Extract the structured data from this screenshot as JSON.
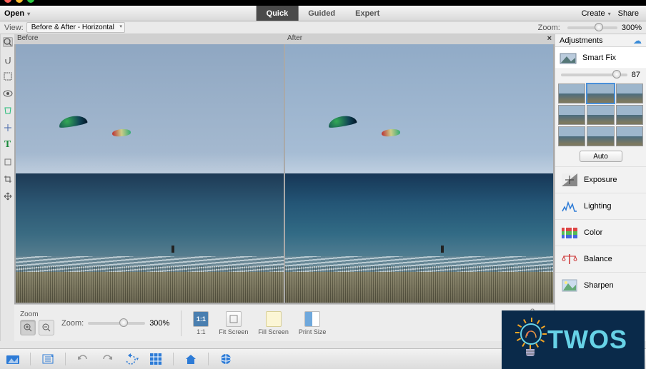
{
  "traffic_lights": [
    "close",
    "minimize",
    "maximize"
  ],
  "menubar": {
    "open_label": "Open",
    "tabs": [
      {
        "label": "Quick",
        "active": true
      },
      {
        "label": "Guided",
        "active": false
      },
      {
        "label": "Expert",
        "active": false
      }
    ],
    "create_label": "Create",
    "share_label": "Share"
  },
  "viewbar": {
    "view_label": "View:",
    "view_mode": "Before & After - Horizontal",
    "zoom_label": "Zoom:",
    "zoom_value": "300%",
    "zoom_slider_pos": 0.55
  },
  "tools": [
    "zoom",
    "hand",
    "select",
    "eye",
    "crop",
    "drop",
    "text",
    "rect",
    "move"
  ],
  "compare": {
    "before_label": "Before",
    "after_label": "After",
    "close_glyph": "×"
  },
  "zoombar": {
    "title": "Zoom",
    "zoom_label": "Zoom:",
    "zoom_value": "300%",
    "slider_pos": 0.55,
    "buttons": [
      {
        "name": "zoom-in-button",
        "glyph": "+",
        "active": true
      },
      {
        "name": "zoom-out-button",
        "glyph": "−",
        "active": false
      }
    ],
    "fit_items": [
      {
        "name": "one-to-one",
        "icon_text": "1:1",
        "label": "1:1"
      },
      {
        "name": "fit-screen",
        "icon_text": "",
        "label": "Fit Screen"
      },
      {
        "name": "fill-screen",
        "icon_text": "",
        "label": "Fill Screen"
      },
      {
        "name": "print-size",
        "icon_text": "",
        "label": "Print Size"
      }
    ],
    "help_glyph": "?",
    "menu_glyph": "▾"
  },
  "adjustments": {
    "header": "Adjustments",
    "cloud_icon": "cloud-sync-icon",
    "smart_fix": {
      "label": "Smart Fix",
      "value": "87",
      "slider_pos": 0.78,
      "auto_label": "Auto",
      "selected_variant_index": 1
    },
    "items": [
      {
        "name": "exposure",
        "label": "Exposure"
      },
      {
        "name": "lighting",
        "label": "Lighting"
      },
      {
        "name": "color",
        "label": "Color"
      },
      {
        "name": "balance",
        "label": "Balance"
      },
      {
        "name": "sharpen",
        "label": "Sharpen"
      }
    ]
  },
  "appbar": {
    "icons": [
      "photo-bin",
      "organizer",
      "undo",
      "redo",
      "rotate",
      "grid",
      "home",
      "layers-globe"
    ]
  },
  "logo": {
    "text": "TWOS"
  },
  "colors": {
    "accent": "#4a90d9",
    "tab_active_bg": "#4a4a4a",
    "twos_bg": "#0a2a4a",
    "twos_text": "#67d2e6"
  }
}
